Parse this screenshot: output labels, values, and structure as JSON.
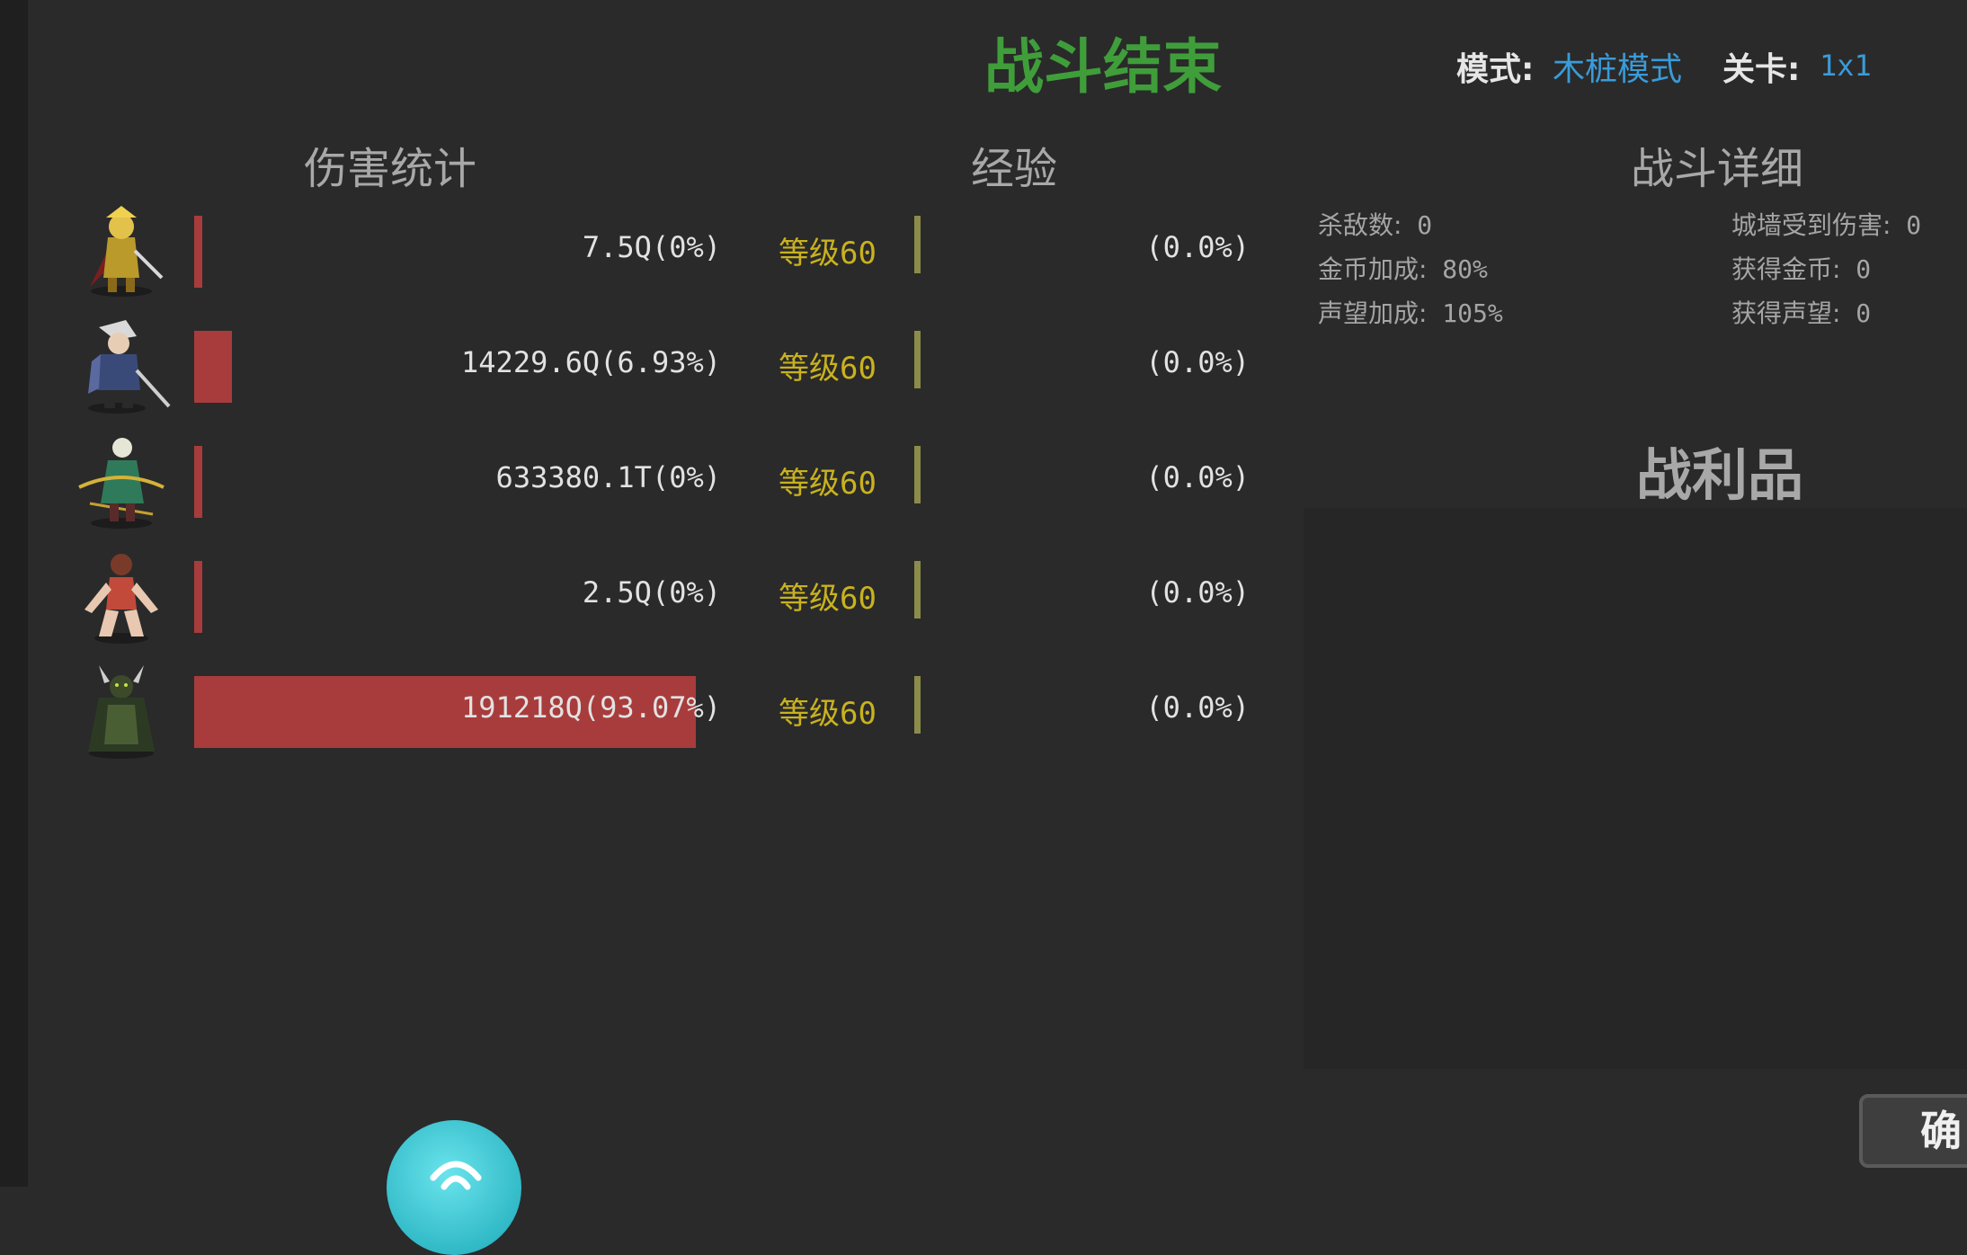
{
  "header": {
    "title": "战斗结束",
    "mode_label": "模式:",
    "mode_value": "木桩模式",
    "stage_label": "关卡:",
    "stage_value": "1x1"
  },
  "columns": {
    "damage": "伤害统计",
    "exp": "经验",
    "details": "战斗详细"
  },
  "heroes": [
    {
      "avatar": "golden-knight-avatar",
      "damage": "7.5Q(0%)",
      "damage_share": 0.0,
      "level": "等级60",
      "exp": "(0.0%)"
    },
    {
      "avatar": "white-haired-swordsman-avatar",
      "damage": "14229.6Q(6.93%)",
      "damage_share": 6.93,
      "level": "等级60",
      "exp": "(0.0%)"
    },
    {
      "avatar": "green-archer-avatar",
      "damage": "633380.1T(0%)",
      "damage_share": 0.0,
      "level": "等级60",
      "exp": "(0.0%)"
    },
    {
      "avatar": "red-dancer-avatar",
      "damage": "2.5Q(0%)",
      "damage_share": 0.0,
      "level": "等级60",
      "exp": "(0.0%)"
    },
    {
      "avatar": "dark-horned-warrior-avatar",
      "damage": "191218Q(93.07%)",
      "damage_share": 93.07,
      "level": "等级60",
      "exp": "(0.0%)"
    }
  ],
  "battle_details": {
    "kills_label": "杀敌数:",
    "kills_value": "0",
    "wall_damage_label": "城墙受到伤害:",
    "wall_damage_value": "0",
    "gold_bonus_label": "金币加成:",
    "gold_bonus_value": "80%",
    "gold_gained_label": "获得金币:",
    "gold_gained_value": "0",
    "rep_bonus_label": "声望加成:",
    "rep_bonus_value": "105%",
    "rep_gained_label": "获得声望:",
    "rep_gained_value": "0"
  },
  "loot": {
    "title": "战利品"
  },
  "confirm_button": {
    "label": "确"
  },
  "colors": {
    "background": "#2a2a2a",
    "title": "#3f9e3a",
    "accent_blue": "#3a9bd8",
    "level_gold": "#c9b21e",
    "damage_bar": "#a83c3c"
  }
}
